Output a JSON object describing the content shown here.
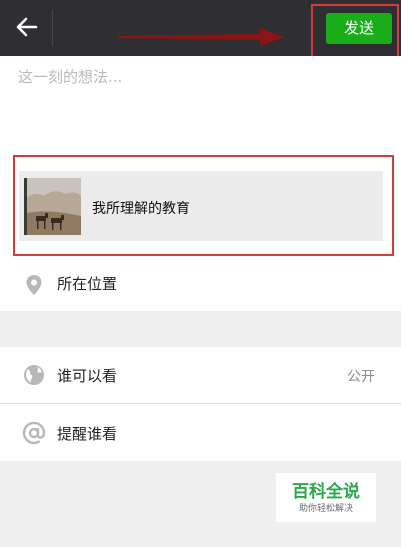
{
  "header": {
    "back_icon": "arrow-left-icon",
    "send_label": "发送",
    "send_color": "#19ad19"
  },
  "compose": {
    "placeholder": "这一刻的想法..."
  },
  "shared_link": {
    "title": "我所理解的教育",
    "thumbnail": "camel-caravan-desert-photo"
  },
  "options": {
    "location_label": "所在位置",
    "location_icon": "location-pin-icon",
    "visibility_label": "谁可以看",
    "visibility_value": "公开",
    "visibility_icon": "globe-icon",
    "mention_label": "提醒谁看",
    "mention_icon": "at-sign-icon"
  },
  "watermark": {
    "title": "百科全说",
    "subtitle": "助你轻松解决"
  },
  "annotation_color": "#d43b3b"
}
